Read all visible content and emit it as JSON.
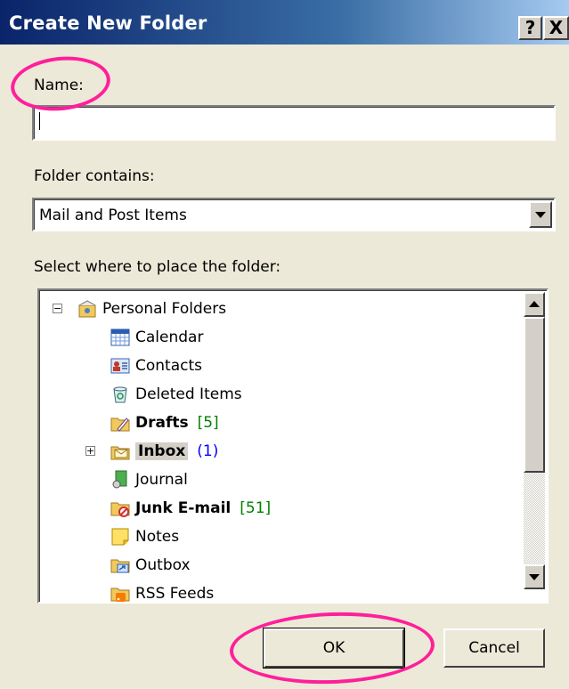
{
  "dialog": {
    "title": "Create New Folder",
    "help_button": "?",
    "close_button": "X"
  },
  "name_field": {
    "label": "Name:",
    "value": ""
  },
  "folder_contains": {
    "label": "Folder contains:",
    "selected": "Mail and Post Items"
  },
  "place": {
    "label": "Select where to place the folder:"
  },
  "tree": {
    "root": {
      "label": "Personal Folders",
      "icon": "personal-folders-icon",
      "expanded": true
    },
    "items": [
      {
        "label": "Calendar",
        "icon": "calendar-icon",
        "bold": false,
        "count": ""
      },
      {
        "label": "Contacts",
        "icon": "contacts-icon",
        "bold": false,
        "count": ""
      },
      {
        "label": "Deleted Items",
        "icon": "deleted-items-icon",
        "bold": false,
        "count": ""
      },
      {
        "label": "Drafts",
        "icon": "drafts-icon",
        "bold": true,
        "count": "[5]"
      },
      {
        "label": "Inbox",
        "icon": "inbox-icon",
        "bold": true,
        "count": "(1)",
        "selected": true,
        "expandable": true
      },
      {
        "label": "Journal",
        "icon": "journal-icon",
        "bold": false,
        "count": ""
      },
      {
        "label": "Junk E-mail",
        "icon": "junk-email-icon",
        "bold": true,
        "count": "[51]"
      },
      {
        "label": "Notes",
        "icon": "notes-icon",
        "bold": false,
        "count": ""
      },
      {
        "label": "Outbox",
        "icon": "outbox-icon",
        "bold": false,
        "count": ""
      },
      {
        "label": "RSS Feeds",
        "icon": "rss-feeds-icon",
        "bold": false,
        "count": ""
      }
    ]
  },
  "buttons": {
    "ok": "OK",
    "cancel": "Cancel"
  },
  "colors": {
    "annotation_circle": "#ff1f9a",
    "count_green": "#008000",
    "count_blue": "#0000ff"
  }
}
